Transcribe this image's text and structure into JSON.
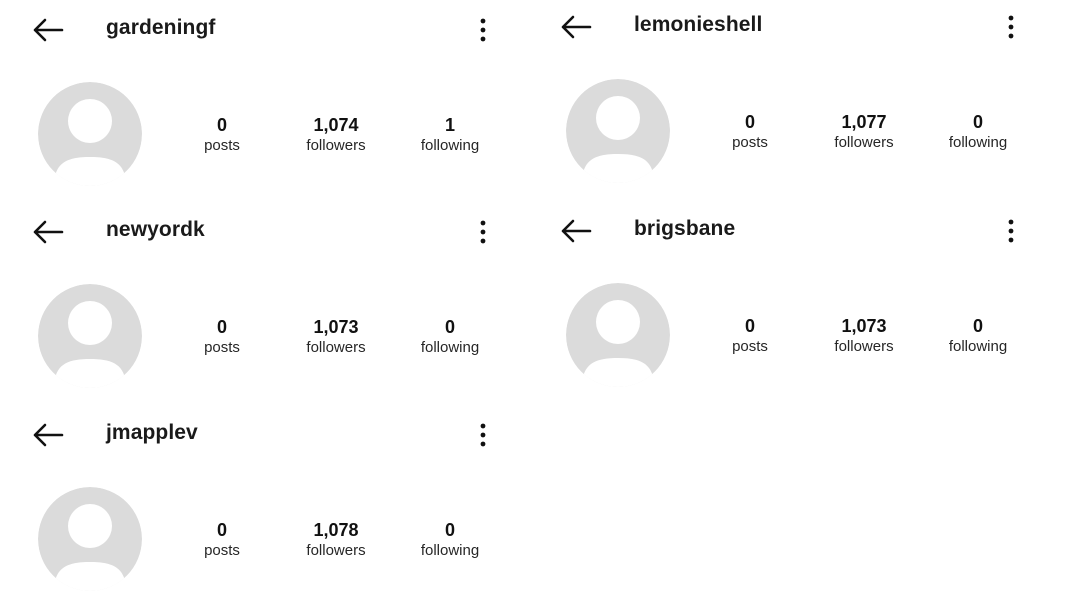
{
  "labels": {
    "posts": "posts",
    "followers": "followers",
    "following": "following"
  },
  "icons": {
    "back": "arrow-left-icon",
    "more": "vertical-ellipsis-icon",
    "avatar": "default-avatar-icon"
  },
  "colors": {
    "avatar_bg": "#dbdbdb",
    "avatar_fg": "#ffffff",
    "text": "#111111"
  },
  "profiles": [
    {
      "username": "gardeningf",
      "posts": "0",
      "followers": "1,074",
      "following": "1"
    },
    {
      "username": "lemonieshell",
      "posts": "0",
      "followers": "1,077",
      "following": "0"
    },
    {
      "username": "newyordk",
      "posts": "0",
      "followers": "1,073",
      "following": "0"
    },
    {
      "username": "brigsbane",
      "posts": "0",
      "followers": "1,073",
      "following": "0"
    },
    {
      "username": "jmapplev",
      "posts": "0",
      "followers": "1,078",
      "following": "0"
    }
  ]
}
